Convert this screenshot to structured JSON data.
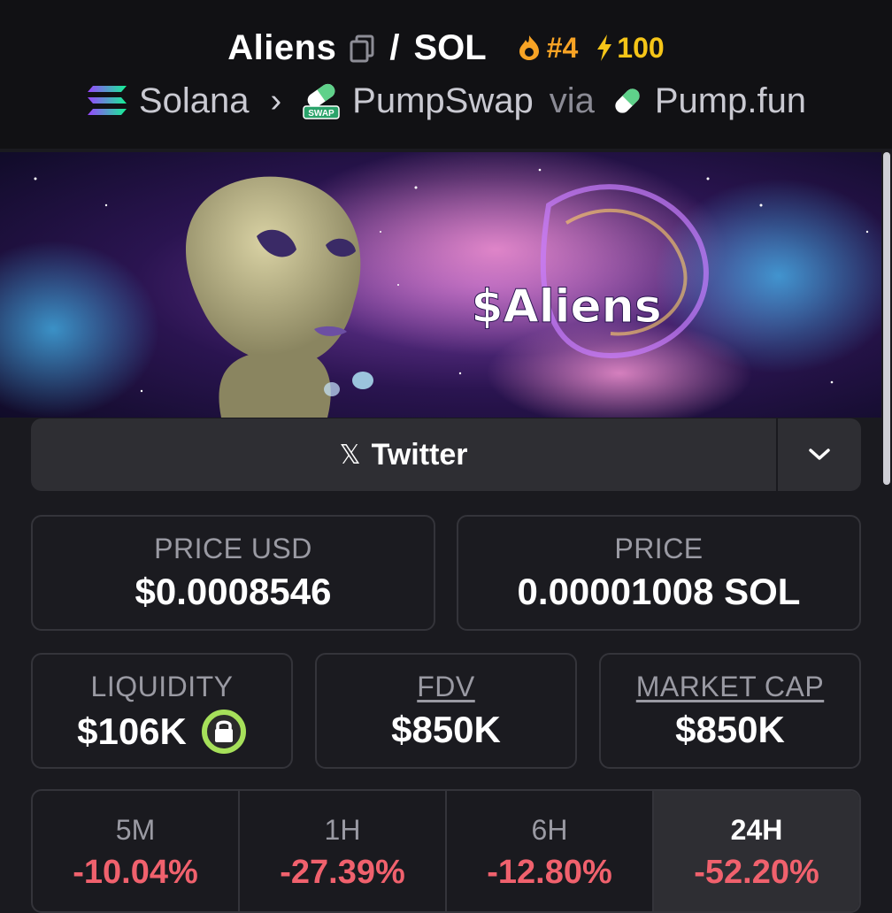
{
  "header": {
    "token": "Aliens",
    "slash": "/",
    "quote": "SOL",
    "rank": "#4",
    "boosts": "100"
  },
  "breadcrumb": {
    "chain": "Solana",
    "dex": "PumpSwap",
    "via": "via",
    "launchpad": "Pump.fun",
    "swap_logo_text": "SWAP"
  },
  "banner": {
    "text": "$Aliens"
  },
  "social": {
    "twitter_label": "Twitter",
    "x_glyph": "𝕏"
  },
  "stats": {
    "price_usd_label": "PRICE USD",
    "price_usd": "$0.0008546",
    "price_label": "PRICE",
    "price_sol": "0.00001008 SOL",
    "liquidity_label": "LIQUIDITY",
    "liquidity": "$106K",
    "fdv_label": "FDV",
    "fdv": "$850K",
    "mcap_label": "MARKET CAP",
    "mcap": "$850K"
  },
  "changes": [
    {
      "period": "5M",
      "value": "-10.04%"
    },
    {
      "period": "1H",
      "value": "-27.39%"
    },
    {
      "period": "6H",
      "value": "-12.80%"
    },
    {
      "period": "24H",
      "value": "-52.20%",
      "active": true
    }
  ],
  "colors": {
    "rank": "#f7a325",
    "boost": "#f5c518",
    "negative": "#f0616d",
    "lock_ring": "#a6e05a"
  }
}
